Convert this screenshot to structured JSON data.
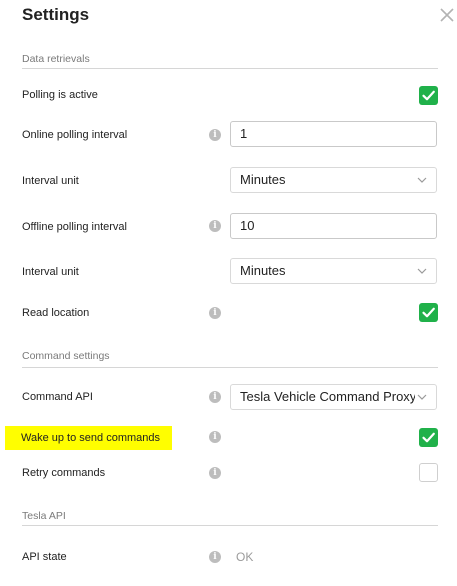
{
  "dialog": {
    "title": "Settings"
  },
  "sections": {
    "data_retrievals": "Data retrievals",
    "command_settings": "Command settings",
    "tesla_api": "Tesla API"
  },
  "fields": {
    "polling_active": {
      "label": "Polling is active",
      "checked": true
    },
    "online_interval": {
      "label": "Online polling interval",
      "value": "1"
    },
    "interval_unit_1": {
      "label": "Interval unit",
      "value": "Minutes"
    },
    "offline_interval": {
      "label": "Offline polling interval",
      "value": "10"
    },
    "interval_unit_2": {
      "label": "Interval unit",
      "value": "Minutes"
    },
    "read_location": {
      "label": "Read location",
      "checked": true
    },
    "command_api": {
      "label": "Command API",
      "value": "Tesla Vehicle Command Proxy"
    },
    "wake_up": {
      "label": "Wake up to send commands",
      "checked": true,
      "highlight_color": "#fffe00"
    },
    "retry_commands": {
      "label": "Retry commands",
      "checked": false
    },
    "api_state": {
      "label": "API state",
      "value": "OK"
    }
  },
  "icons": {
    "info": "i",
    "close": "close-icon",
    "chevron": "chevron-down-icon",
    "check": "checkmark-icon"
  },
  "colors": {
    "checkbox_on": "#20b14a",
    "divider": "#d6d6d6",
    "highlight": "#fffe00"
  }
}
